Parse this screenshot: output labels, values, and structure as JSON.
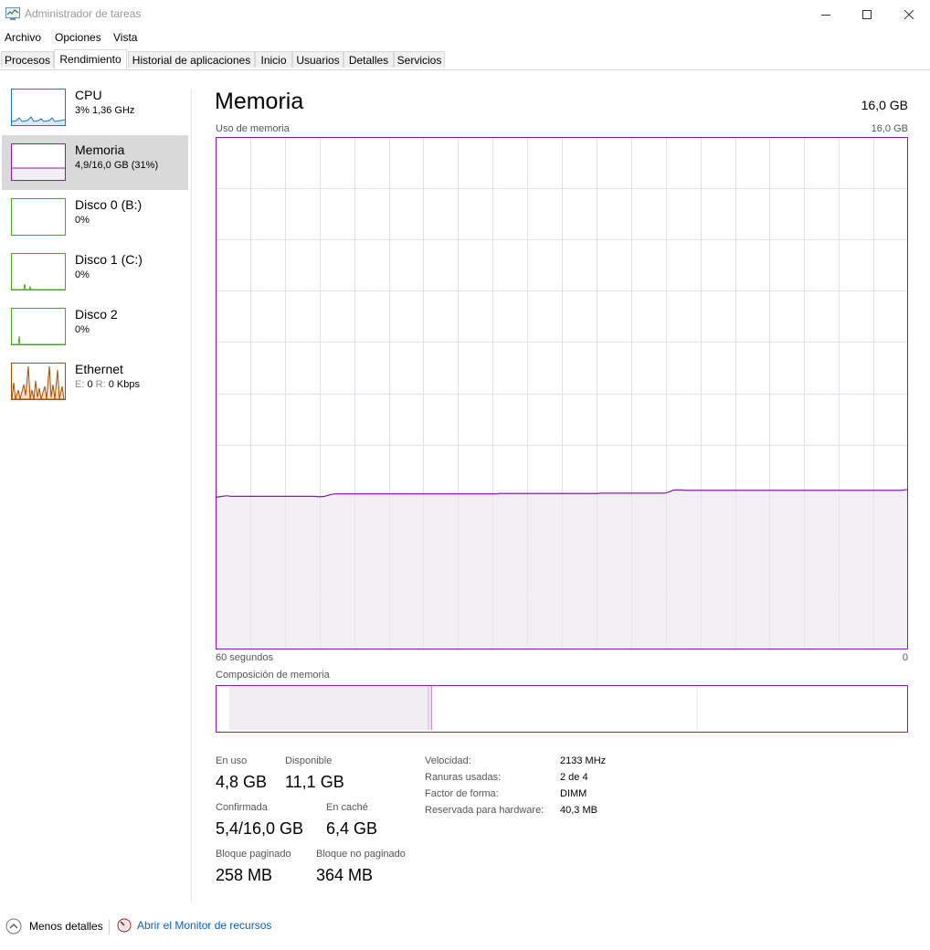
{
  "window": {
    "title": "Administrador de tareas",
    "minimize_icon": "minimize-icon",
    "maximize_icon": "maximize-icon",
    "close_icon": "close-icon"
  },
  "menu": {
    "items": [
      "Archivo",
      "Opciones",
      "Vista"
    ]
  },
  "tabs": [
    {
      "label": "Procesos",
      "active": false
    },
    {
      "label": "Rendimiento",
      "active": true
    },
    {
      "label": "Historial de aplicaciones",
      "active": false
    },
    {
      "label": "Inicio",
      "active": false
    },
    {
      "label": "Usuarios",
      "active": false
    },
    {
      "label": "Detalles",
      "active": false
    },
    {
      "label": "Servicios",
      "active": false
    }
  ],
  "sidebar": {
    "items": [
      {
        "name": "CPU",
        "sub": "3%  1,36 GHz",
        "color": "#1a7ab5",
        "selected": false
      },
      {
        "name": "Memoria",
        "sub": "4,9/16,0 GB (31%)",
        "color": "#8b1aa8",
        "selected": true
      },
      {
        "name": "Disco 0 (B:)",
        "sub": "0%",
        "color": "#4ca623",
        "selected": false
      },
      {
        "name": "Disco 1 (C:)",
        "sub": "0%",
        "color": "#4ca623",
        "selected": false
      },
      {
        "name": "Disco 2",
        "sub": "0%",
        "color": "#4ca623",
        "selected": false
      },
      {
        "name": "Ethernet",
        "sub_send_label": "E:",
        "sub_send": "0",
        "sub_recv_label": "R:",
        "sub_recv": "0 Kbps",
        "color": "#a74f01",
        "selected": false
      }
    ]
  },
  "main": {
    "title": "Memoria",
    "total": "16,0 GB",
    "usage_label": "Uso de memoria",
    "usage_max": "16,0 GB",
    "time_left": "60 segundos",
    "time_right": "0",
    "composition_label": "Composición de memoria",
    "accent_color": "#8b1aa8"
  },
  "stats": {
    "in_use_label": "En uso",
    "in_use": "4,8 GB",
    "available_label": "Disponible",
    "available": "11,1 GB",
    "committed_label": "Confirmada",
    "committed": "5,4/16,0 GB",
    "cached_label": "En caché",
    "cached": "6,4 GB",
    "paged_label": "Bloque paginado",
    "paged": "258 MB",
    "nonpaged_label": "Bloque no paginado",
    "nonpaged": "364 MB"
  },
  "hardware": {
    "speed_label": "Velocidad:",
    "speed": "2133 MHz",
    "slots_label": "Ranuras usadas:",
    "slots": "2 de 4",
    "form_label": "Factor de forma:",
    "form": "DIMM",
    "reserved_label": "Reservada para hardware:",
    "reserved": "40,3 MB"
  },
  "footer": {
    "fewer_details": "Menos detalles",
    "resource_monitor": "Abrir el Monitor de recursos",
    "link_color": "#0b5fb0"
  },
  "chart_data": {
    "type": "area",
    "title": "Uso de memoria",
    "xlabel": "",
    "ylabel": "",
    "x_range_seconds": [
      60,
      0
    ],
    "ylim": [
      0,
      16
    ],
    "y_unit": "GB",
    "grid": true,
    "series": [
      {
        "values": [
          4.76,
          4.76,
          4.77,
          4.78,
          4.79,
          4.8,
          4.79,
          4.78,
          4.78,
          4.78,
          4.78,
          4.78,
          4.78,
          4.78,
          4.78,
          4.78,
          4.78,
          4.78,
          4.78,
          4.78,
          4.78,
          4.78,
          4.78,
          4.78,
          4.78,
          4.78,
          4.78,
          4.78,
          4.78,
          4.78,
          4.78,
          4.78,
          4.78,
          4.78,
          4.78,
          4.78,
          4.78,
          4.78,
          4.78,
          4.78,
          4.78,
          4.78,
          4.78,
          4.78,
          4.78,
          4.78,
          4.77,
          4.77,
          4.77,
          4.78,
          4.8,
          4.82,
          4.84,
          4.85,
          4.86,
          4.86,
          4.86,
          4.86,
          4.86,
          4.86,
          4.86,
          4.86,
          4.86,
          4.86,
          4.86,
          4.86,
          4.86,
          4.86,
          4.86,
          4.86,
          4.86,
          4.86,
          4.86,
          4.86,
          4.86,
          4.86,
          4.86,
          4.86,
          4.86,
          4.86,
          4.86,
          4.86,
          4.86,
          4.86,
          4.86,
          4.86,
          4.86,
          4.86,
          4.86,
          4.86,
          4.86,
          4.86,
          4.86,
          4.86,
          4.86,
          4.86,
          4.86,
          4.86,
          4.86,
          4.86,
          4.86,
          4.86,
          4.86,
          4.86,
          4.86,
          4.86,
          4.86,
          4.86,
          4.86,
          4.86,
          4.86,
          4.86,
          4.86,
          4.86,
          4.86,
          4.86,
          4.86,
          4.86,
          4.86,
          4.86,
          4.86,
          4.86,
          4.86,
          4.86,
          4.86,
          4.86,
          4.86,
          4.86,
          4.87,
          4.87,
          4.87,
          4.87,
          4.87,
          4.87,
          4.87,
          4.87,
          4.87,
          4.87,
          4.87,
          4.87,
          4.87,
          4.87,
          4.87,
          4.87,
          4.87,
          4.87,
          4.87,
          4.87,
          4.87,
          4.87,
          4.87,
          4.87,
          4.87,
          4.87,
          4.87,
          4.87,
          4.87,
          4.87,
          4.87,
          4.87,
          4.87,
          4.87,
          4.87,
          4.87,
          4.87,
          4.87,
          4.87,
          4.87,
          4.87,
          4.87,
          4.87,
          4.87,
          4.87,
          4.88,
          4.88,
          4.88,
          4.88,
          4.88,
          4.88,
          4.88,
          4.88,
          4.88,
          4.88,
          4.88,
          4.88,
          4.88,
          4.88,
          4.88,
          4.88,
          4.88,
          4.88,
          4.88,
          4.88,
          4.88,
          4.88,
          4.88,
          4.88,
          4.88,
          4.88,
          4.88,
          4.88,
          4.88,
          4.88,
          4.89,
          4.91,
          4.94,
          4.97,
          4.98,
          4.98,
          4.98,
          4.98,
          4.97,
          4.97,
          4.97,
          4.97,
          4.97,
          4.97,
          4.97,
          4.97,
          4.97,
          4.97,
          4.97,
          4.97,
          4.97,
          4.97,
          4.97,
          4.97,
          4.97,
          4.97,
          4.97,
          4.97,
          4.97,
          4.97,
          4.97,
          4.97,
          4.97,
          4.97,
          4.97,
          4.97,
          4.97,
          4.97,
          4.97,
          4.97,
          4.97,
          4.97,
          4.97,
          4.97,
          4.97,
          4.97,
          4.97,
          4.97,
          4.97,
          4.97,
          4.97,
          4.97,
          4.97,
          4.97,
          4.97,
          4.97,
          4.97,
          4.97,
          4.97,
          4.97,
          4.97,
          4.97,
          4.97,
          4.97,
          4.97,
          4.97,
          4.97,
          4.97,
          4.97,
          4.97,
          4.97,
          4.97,
          4.97,
          4.97,
          4.97,
          4.97,
          4.97,
          4.97,
          4.97,
          4.97,
          4.97,
          4.97,
          4.97,
          4.97,
          4.97,
          4.97,
          4.97,
          4.97,
          4.97,
          4.97,
          4.97,
          4.97,
          4.97,
          4.97,
          4.97,
          4.97,
          4.97,
          4.97,
          4.97,
          4.97,
          4.97,
          4.97,
          4.97,
          4.97,
          4.97,
          4.97,
          4.97,
          4.98,
          4.99,
          4.99
        ]
      }
    ]
  },
  "composition_data": {
    "in_use_gb": 4.8,
    "modified_gb": 0.07,
    "standby_gb": 6.4,
    "free_gb": 4.7,
    "total_gb": 16.0
  }
}
